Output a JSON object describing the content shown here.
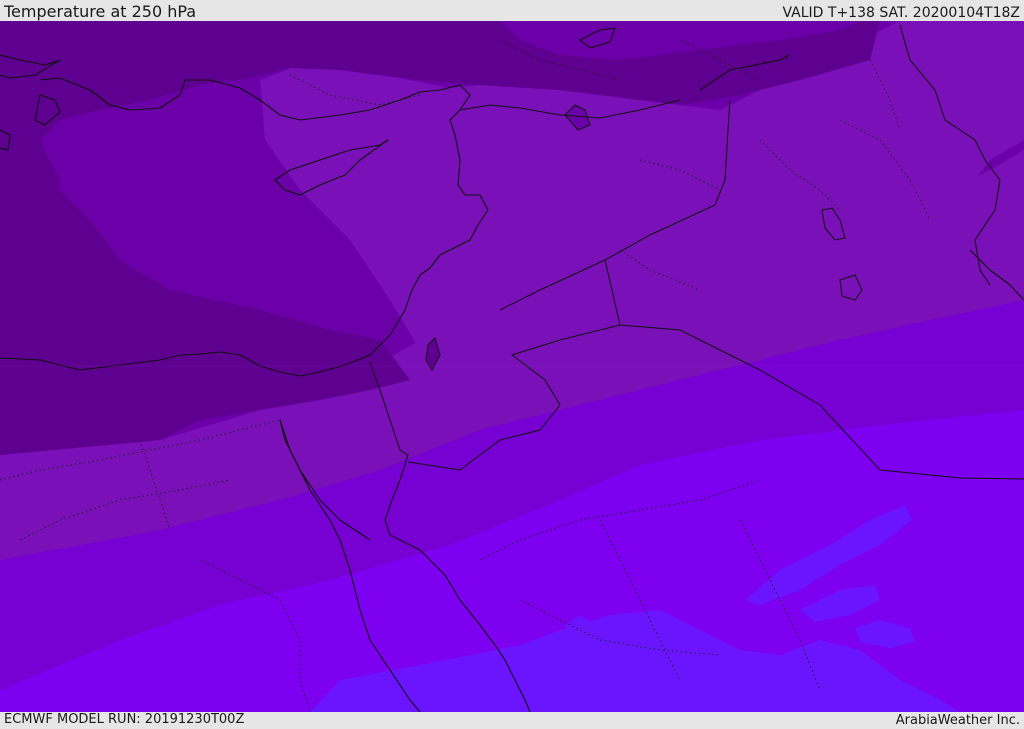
{
  "header": {
    "title": "Temperature at 250 hPa",
    "valid": "VALID T+138 SAT. 20200104T18Z"
  },
  "footer": {
    "model_run": "ECMWF MODEL RUN: 20191230T00Z",
    "credit": "ArabiaWeather Inc."
  },
  "colors": {
    "band_coldest": "#5e0090",
    "band_cold": "#6c00a8",
    "band_mid": "#7a10b8",
    "band_mild": "#7700d2",
    "band_warm": "#7d00f0",
    "band_warmest": "#6b14ff",
    "bar_background": "#e6e6e6"
  }
}
